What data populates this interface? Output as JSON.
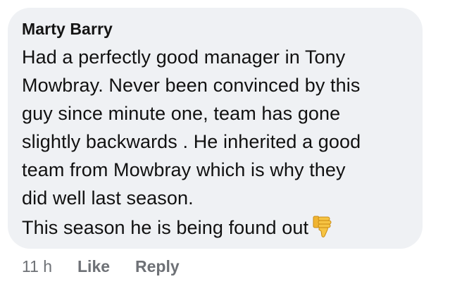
{
  "comment": {
    "author": "Marty Barry",
    "lines": [
      "Had a perfectly good manager in Tony",
      "Mowbray. Never been convinced by this",
      "guy since minute one, team has gone",
      "slightly backwards . He inherited a good",
      "team from Mowbray which is why they",
      "did well last season.",
      "This season he is being found out"
    ],
    "emoji": "thumbs-down-icon"
  },
  "actions": {
    "timestamp": "11 h",
    "like_label": "Like",
    "reply_label": "Reply"
  },
  "colors": {
    "bubble": "#eff1f4",
    "text": "#111111",
    "meta": "#6e7176",
    "emoji": "#f6c443"
  }
}
